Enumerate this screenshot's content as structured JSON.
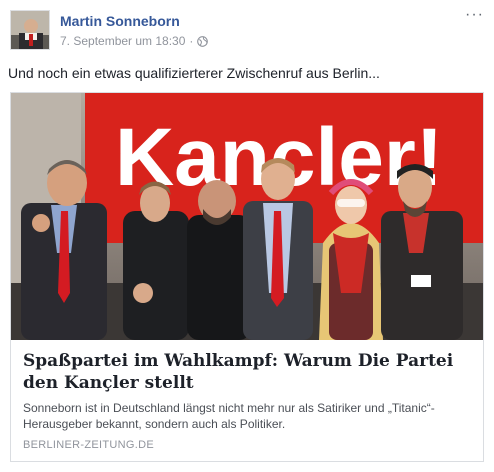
{
  "post": {
    "author_name": "Martin Sonneborn",
    "timestamp": "7. September um 18:30",
    "separator": "·",
    "privacy_icon": "globe-icon",
    "more_icon": "more-options-icon",
    "more_label": "···",
    "text": "Und noch ein etwas qualifizierterer Zwischenruf aus Berlin..."
  },
  "link_preview": {
    "image_banner_text": "Kancler!",
    "title": "Spaßpartei im Wahlkampf: Warum Die Partei den Kançler stellt",
    "description": "Sonneborn ist in Deutschland längst nicht mehr nur als Satiriker und „Titanic“-Herausgeber bekannt, sondern auch als Politiker.",
    "domain": "BERLINER-ZEITUNG.DE"
  },
  "colors": {
    "author_link": "#365899",
    "banner_red": "#d8231c",
    "tie_red": "#d41b22",
    "meta_gray": "#90949c"
  }
}
